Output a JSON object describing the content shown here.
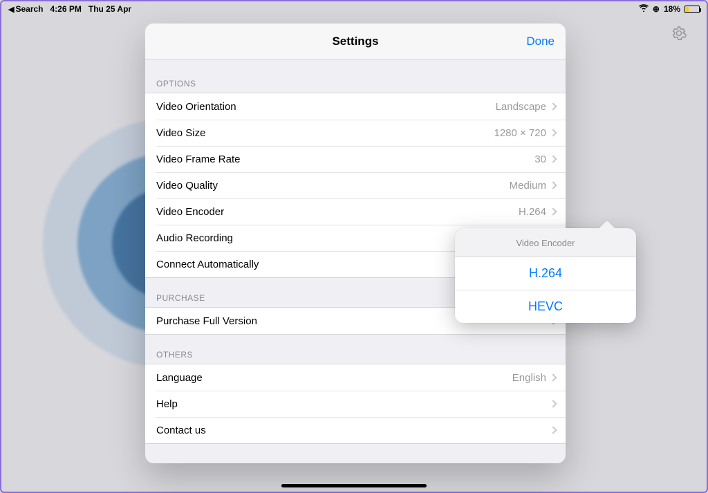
{
  "statusbar": {
    "back_label": "Search",
    "time": "4:26 PM",
    "date": "Thu 25 Apr",
    "battery_pct": "18%",
    "battery_fill_pct": 18
  },
  "sheet": {
    "title": "Settings",
    "done": "Done"
  },
  "sections": {
    "options_header": "OPTIONS",
    "purchase_header": "PURCHASE",
    "others_header": "OTHERS"
  },
  "options": {
    "video_orientation": {
      "label": "Video Orientation",
      "value": "Landscape"
    },
    "video_size": {
      "label": "Video Size",
      "value": "1280 × 720"
    },
    "video_frame_rate": {
      "label": "Video Frame Rate",
      "value": "30"
    },
    "video_quality": {
      "label": "Video Quality",
      "value": "Medium"
    },
    "video_encoder": {
      "label": "Video Encoder",
      "value": "H.264"
    },
    "audio_recording": {
      "label": "Audio Recording",
      "value": ""
    },
    "connect_auto": {
      "label": "Connect Automatically",
      "value": ""
    }
  },
  "purchase": {
    "full_version": {
      "label": "Purchase Full Version",
      "value": ""
    }
  },
  "others": {
    "language": {
      "label": "Language",
      "value": "English"
    },
    "help": {
      "label": "Help",
      "value": ""
    },
    "contact": {
      "label": "Contact us",
      "value": ""
    }
  },
  "popover": {
    "title": "Video Encoder",
    "items": [
      "H.264",
      "HEVC"
    ]
  }
}
